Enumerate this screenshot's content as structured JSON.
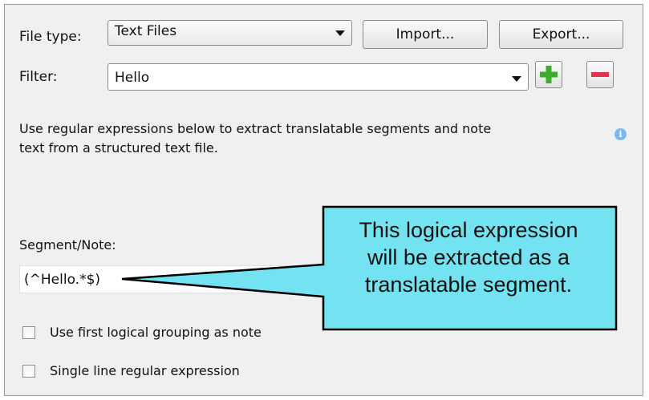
{
  "file_type": {
    "label": "File type:",
    "value": "Text Files"
  },
  "buttons": {
    "import": "Import...",
    "export": "Export..."
  },
  "filter": {
    "label": "Filter:",
    "value": "Hello"
  },
  "description": {
    "line1": "Use regular expressions below to extract translatable segments and note",
    "line2": "text from a structured text file."
  },
  "info_icon": "i",
  "segment_note": {
    "label": "Segment/Note:",
    "value": "(^Hello.*$)"
  },
  "checkboxes": {
    "first_grouping": "Use first logical grouping as note",
    "single_line": "Single line regular expression"
  },
  "callout": {
    "line1": "This logical expression",
    "line2": "will be extracted as a",
    "line3": "translatable segment."
  },
  "colors": {
    "callout_fill": "#73e3f1",
    "add_icon": "#3cae2c",
    "remove_icon": "#e3324c",
    "info_icon": "#7fb6ea"
  },
  "icons": [
    "chevron-down-icon",
    "plus-icon",
    "minus-icon",
    "info-icon"
  ]
}
